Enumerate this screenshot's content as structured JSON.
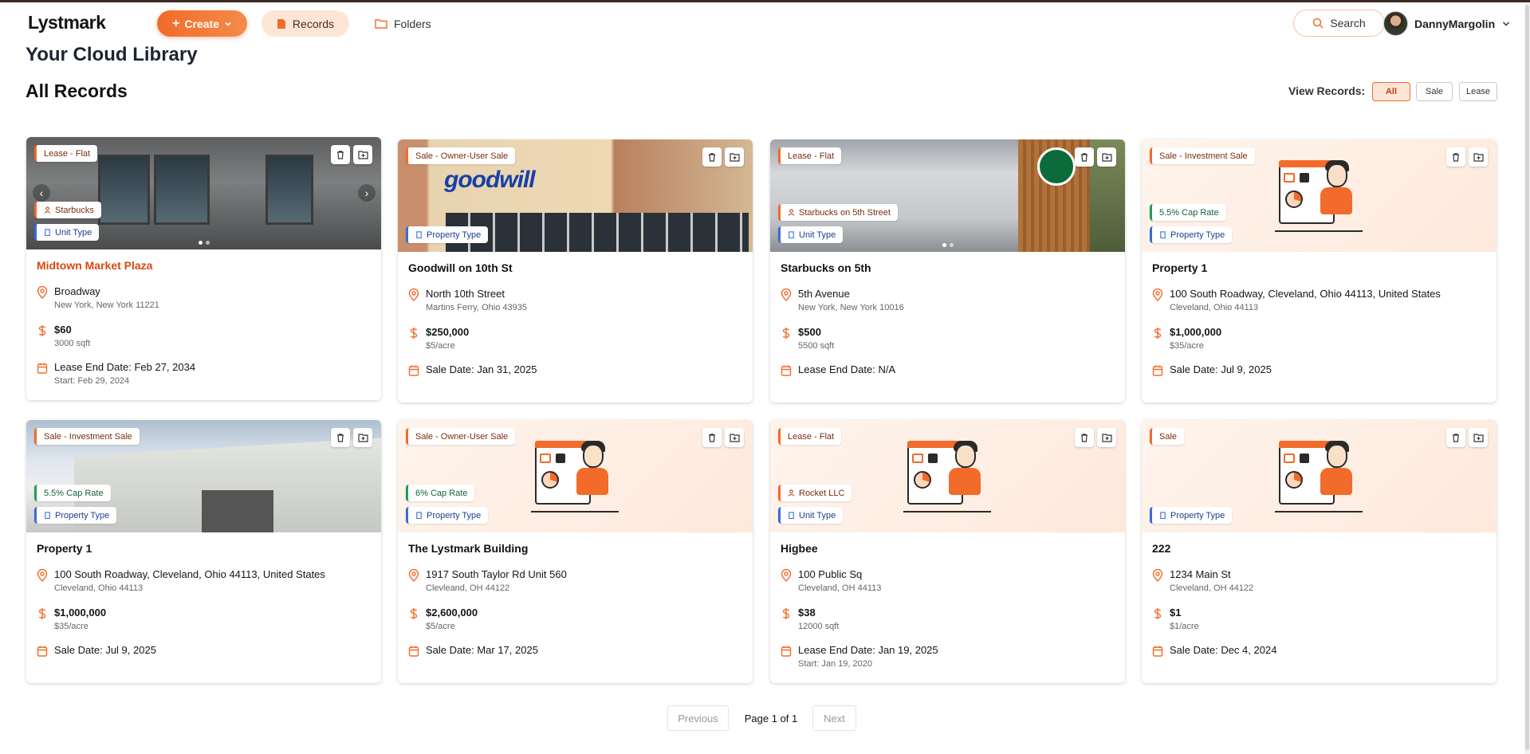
{
  "nav": {
    "logo": "Lystmark",
    "create_label": "Create",
    "records_label": "Records",
    "folders_label": "Folders",
    "search_label": "Search",
    "user_name": "DannyMargolin"
  },
  "header": {
    "page_title": "Your Cloud Library",
    "section_title": "All Records",
    "view_label": "View Records:",
    "filters": [
      "All",
      "Sale",
      "Lease"
    ],
    "active_filter": "All"
  },
  "colors": {
    "accent": "#f26b2a",
    "accent_soft": "#fde6d6",
    "green_tag": "#1f9d55",
    "blue_tag": "#3b6bd9"
  },
  "cards": [
    {
      "type_tag": "Lease - Flat",
      "tenant_tag": "Starbucks",
      "unit_tag": "Unit Type",
      "title": "Midtown Market Plaza",
      "address": "Broadway",
      "city": "New York, New York 11221",
      "price": "$60",
      "price_sub": "3000 sqft",
      "date": "Lease End Date: Feb 27, 2034",
      "date_sub": "Start: Feb 29, 2024"
    },
    {
      "type_tag": "Sale - Owner-User Sale",
      "unit_tag": "Property Type",
      "title": "Goodwill on 10th St",
      "address": "North 10th Street",
      "city": "Martins Ferry, Ohio 43935",
      "price": "$250,000",
      "price_sub": "$5/acre",
      "date": "Sale Date: Jan 31, 2025",
      "sign_text": "goodwill"
    },
    {
      "type_tag": "Lease - Flat",
      "tenant_tag": "Starbucks on 5th Street",
      "unit_tag": "Unit Type",
      "title": "Starbucks on 5th",
      "address": "5th Avenue",
      "city": "New York, New York 10016",
      "price": "$500",
      "price_sub": "5500 sqft",
      "date": "Lease End Date: N/A"
    },
    {
      "type_tag": "Sale - Investment Sale",
      "cap_tag": "5.5% Cap Rate",
      "unit_tag": "Property Type",
      "title": "Property 1",
      "address": "100 South Roadway, Cleveland, Ohio 44113, United States",
      "city": "Cleveland, Ohio 44113",
      "price": "$1,000,000",
      "price_sub": "$35/acre",
      "date": "Sale Date: Jul 9, 2025"
    },
    {
      "type_tag": "Sale - Investment Sale",
      "cap_tag": "5.5% Cap Rate",
      "unit_tag": "Property Type",
      "title": "Property 1",
      "address": "100 South Roadway, Cleveland, Ohio 44113, United States",
      "city": "Cleveland, Ohio 44113",
      "price": "$1,000,000",
      "price_sub": "$35/acre",
      "date": "Sale Date: Jul 9, 2025"
    },
    {
      "type_tag": "Sale - Owner-User Sale",
      "cap_tag": "6% Cap Rate",
      "unit_tag": "Property Type",
      "title": "The Lystmark Building",
      "address": "1917 South Taylor Rd Unit 560",
      "city": "Clevleand, OH 44122",
      "price": "$2,600,000",
      "price_sub": "$5/acre",
      "date": "Sale Date: Mar 17, 2025"
    },
    {
      "type_tag": "Lease - Flat",
      "tenant_tag": "Rocket LLC",
      "unit_tag": "Unit Type",
      "title": "Higbee",
      "address": "100 Public Sq",
      "city": "Cleveland, OH 44113",
      "price": "$38",
      "price_sub": "12000 sqft",
      "date": "Lease End Date: Jan 19, 2025",
      "date_sub": "Start: Jan 19, 2020"
    },
    {
      "type_tag": "Sale",
      "unit_tag": "Property Type",
      "title": "222",
      "address": "1234 Main St",
      "city": "Cleveland, OH 44122",
      "price": "$1",
      "price_sub": "$1/acre",
      "date": "Sale Date: Dec 4, 2024"
    }
  ],
  "pagination": {
    "prev_label": "Previous",
    "info": "Page 1 of 1",
    "next_label": "Next"
  }
}
